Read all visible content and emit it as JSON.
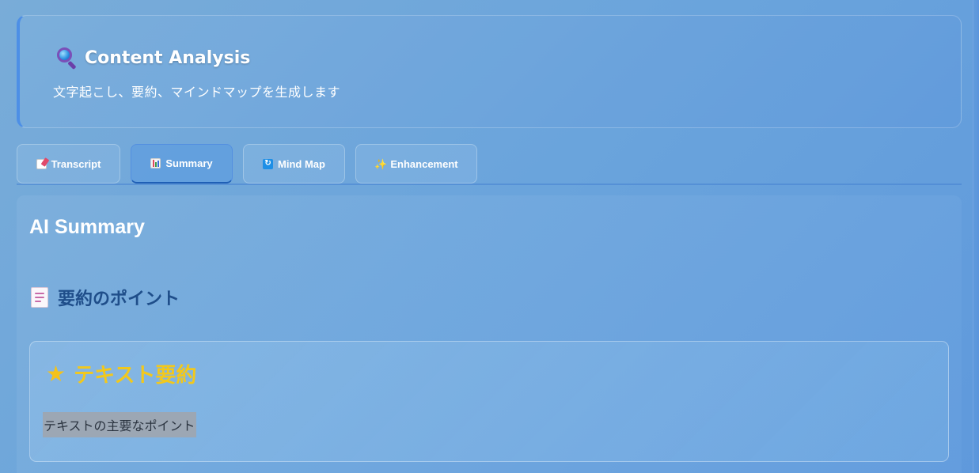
{
  "header": {
    "title": "Content Analysis",
    "subtitle": "文字起こし、要約、マインドマップを生成します",
    "icon": "magnifier-icon"
  },
  "tabs": [
    {
      "label": "Transcript",
      "icon": "memo-icon",
      "active": false
    },
    {
      "label": "Summary",
      "icon": "bar-chart-icon",
      "active": true
    },
    {
      "label": "Mind Map",
      "icon": "refresh-icon",
      "active": false
    },
    {
      "label": "Enhancement",
      "icon": "sparkles-icon",
      "active": false
    }
  ],
  "main": {
    "title": "AI Summary",
    "section": {
      "heading": "要約のポイント",
      "icon": "document-icon"
    },
    "card": {
      "title": "テキスト要約",
      "icon": "star-icon",
      "text": "テキストの主要なポイント"
    }
  },
  "colors": {
    "accent": "#4d8fe6",
    "heading": "#1f4e8a",
    "star": "#f2c81c"
  }
}
